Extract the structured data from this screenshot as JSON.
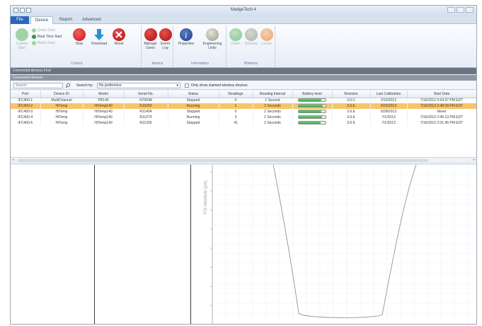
{
  "window": {
    "title": "MadgeTech 4"
  },
  "tabs": [
    {
      "label": "File"
    },
    {
      "label": "Device"
    },
    {
      "label": "Report"
    },
    {
      "label": "Advanced"
    }
  ],
  "ribbon": {
    "control": {
      "label": "Control",
      "custom_start": "Custom Start",
      "quick_start": "Quick Start",
      "real_time_start": "Real Time Start",
      "batch_start": "Batch Start",
      "stop": "Stop",
      "download": "Download",
      "reset": "Reset"
    },
    "alarms": {
      "label": "Alarms",
      "manage_users": "Manage Users",
      "event_log": "Event Log"
    },
    "information": {
      "label": "Information",
      "properties": "Properties",
      "engineering_units": "Engineering Units"
    },
    "wireless": {
      "label": "Wireless",
      "claim": "Claim",
      "release": "Release",
      "locate": "Locate"
    }
  },
  "panels": {
    "connected_devices_tab": "Connected devices  Find",
    "connected_devices_header": "Connected devices"
  },
  "search": {
    "placeholder": "Search",
    "search_by_label": "Search by:",
    "search_by_value": "No preference",
    "only_wireless_label": "Only show claimed wireless devices"
  },
  "table": {
    "columns": [
      "Port",
      "Device ID",
      "Model",
      "Serial No.",
      "Status",
      "Readings",
      "Reading Interval",
      "Battery level",
      "Revision",
      "Last Calibration",
      "Start Date"
    ],
    "rows": [
      {
        "port": "IFC400-1",
        "device_id": "MultiChannel",
        "model": "PR140",
        "serial": "N70048",
        "status": "Stopped",
        "readings": "0",
        "interval": "1 Second",
        "battery": 0.85,
        "revision": "3.0.C",
        "last_cal": "2/15/2012",
        "start_date": "7/16/2012 5:04:37 PM EDT",
        "selected": false
      },
      {
        "port": "IFC400-2",
        "device_id": "HiTemp",
        "model": "HiTemp140",
        "serial": "R10250",
        "status": "Running",
        "readings": "1",
        "interval": "2 Seconds",
        "battery": 0.9,
        "revision": "3.6.E",
        "last_cal": "6/25/2013",
        "start_date": "7/16/2013 2:48:39 PM EDT",
        "selected": true
      },
      {
        "port": "IFC400-3",
        "device_id": "HiTemp",
        "model": "HiTemp140",
        "serial": "R11404",
        "status": "Stopped",
        "readings": "0",
        "interval": "2 Seconds",
        "battery": 0.85,
        "revision": "3.6.E",
        "last_cal": "6/28/2013",
        "start_date": "Never",
        "selected": false
      },
      {
        "port": "IFC400-4",
        "device_id": "HiTemp",
        "model": "HiTemp140",
        "serial": "R11279",
        "status": "Running",
        "readings": "3",
        "interval": "2 Seconds",
        "battery": 0.88,
        "revision": "3.6.E",
        "last_cal": "7/1/2013",
        "start_date": "7/16/2013 2:46:13 PM EDT",
        "selected": false
      },
      {
        "port": "IFC400-5",
        "device_id": "HiTemp",
        "model": "HiTemp140",
        "serial": "R11205",
        "status": "Stopped",
        "readings": "41",
        "interval": "2 Seconds",
        "battery": 0.82,
        "revision": "3.6.E",
        "last_cal": "7/1/2013",
        "start_date": "7/16/2013 2:01:45 PM EDT",
        "selected": false
      }
    ]
  },
  "chart": {
    "ylabel": "PSI Absolute (psi)"
  },
  "colors": {
    "file_tab": "#2a67bd",
    "selected_row": "#f7c46a",
    "battery_fill": "#35a34a",
    "header_band": "#6a7380"
  }
}
